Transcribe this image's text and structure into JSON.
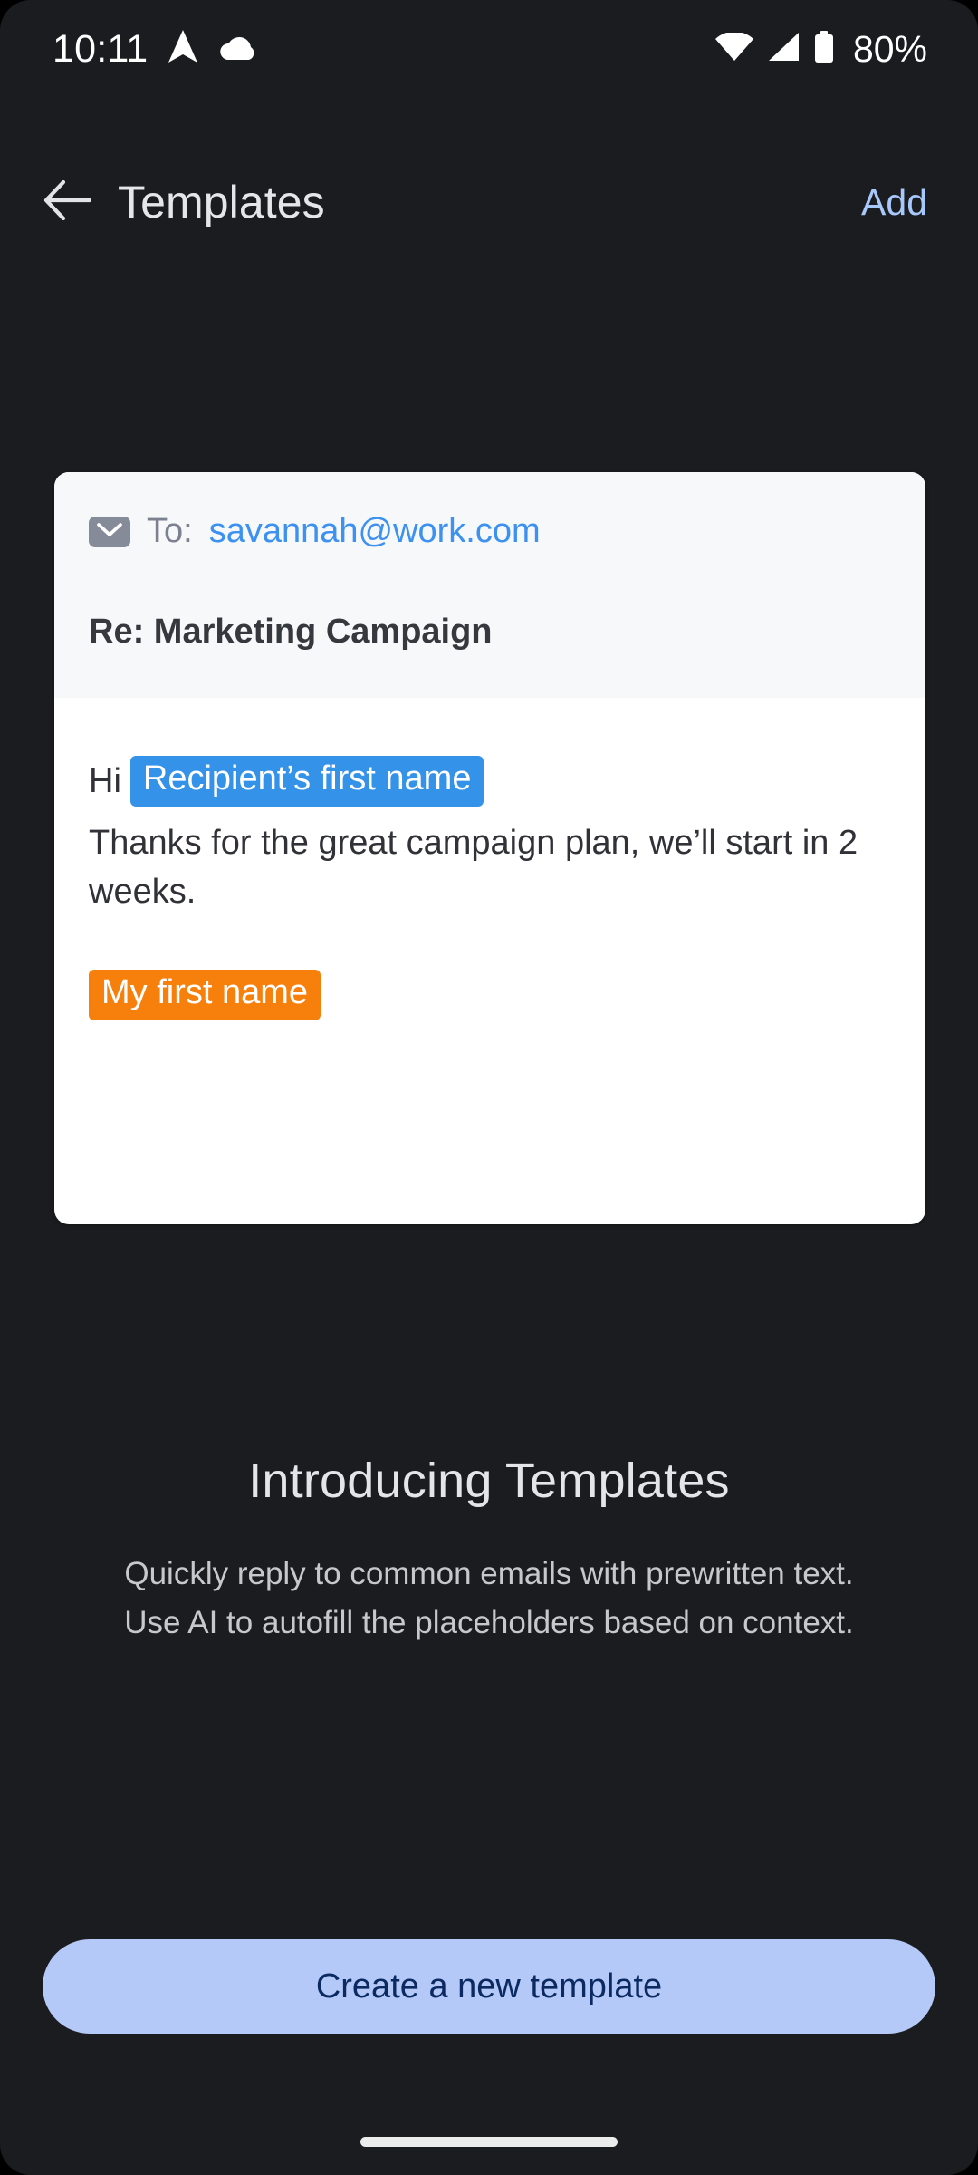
{
  "status_bar": {
    "time": "10:11",
    "icons_left": [
      "navigation-arrow-icon",
      "cloud-icon"
    ],
    "icons_right": [
      "wifi-icon",
      "cell-signal-icon",
      "battery-icon"
    ],
    "battery_level": "80%"
  },
  "app_bar": {
    "back_icon": "back-arrow-icon",
    "title": "Templates",
    "action_label": "Add",
    "action_color": "#A8C7FA"
  },
  "template_card": {
    "mail_icon": "envelope-icon",
    "to_label": "To:",
    "to_email": "savannah@work.com",
    "to_email_color": "#3D91F0",
    "subject": "Re: Marketing Campaign",
    "greeting": "Hi",
    "placeholder_recipient": "Recipient’s first name",
    "placeholder_recipient_color": "#3492E8",
    "body": "Thanks  for the great campaign plan, we’ll start in 2 weeks.",
    "placeholder_sender": "My first name",
    "placeholder_sender_color": "#F77F0C"
  },
  "hero": {
    "title": "Introducing Templates",
    "description": "Quickly reply to common emails with prewritten text. Use AI to autofill the placeholders based on context."
  },
  "cta": {
    "label": "Create a new template",
    "background": "#B4C9F8",
    "text_color": "#0A2A61"
  },
  "system": {
    "home_indicator": "home-indicator"
  }
}
